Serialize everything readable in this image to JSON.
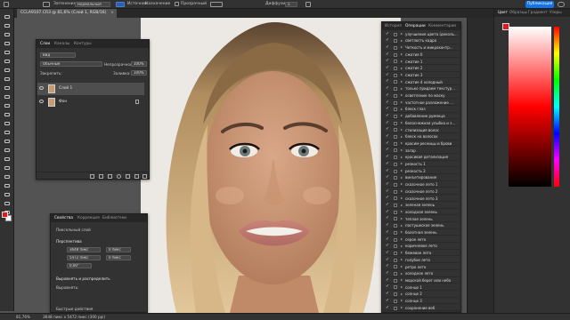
{
  "options_bar": {
    "mode_label": "Затенение:",
    "mode_value": "Нормальный",
    "opacity_label": "Непрозр.:",
    "opacity_value": "100%",
    "flow_label": "Нажим:",
    "flow_value": "100%",
    "source_label": "Источник",
    "destination_label": "Назначение",
    "transparent_label": "Прозрачный",
    "diffusion_label": "Диффузия:",
    "diffusion_value": "5",
    "publish_label": "Публикация"
  },
  "document_tab": {
    "title": "CCLA9107.CR3 @ 81,6% (Слой 1, RGB/16)",
    "close_glyph": "×"
  },
  "layers_panel": {
    "tabs": [
      "Слои",
      "Каналы",
      "Контуры"
    ],
    "kind_filter": "Вид",
    "blend_mode": "Обычные",
    "opacity_label": "Непрозрачность:",
    "opacity_value": "100%",
    "lock_label": "Закрепить:",
    "fill_label": "Заливка:",
    "fill_value": "100%",
    "layers": [
      {
        "name": "Слой 1"
      },
      {
        "name": "Фон"
      }
    ]
  },
  "properties_panel": {
    "tabs": [
      "Свойства",
      "Коррекция",
      "Библиотеки"
    ],
    "layer_type": "Пиксельный слой",
    "transform_label": "Перспектива",
    "width": "3648 пикс",
    "x": "0 пикс",
    "height": "5472 пикс",
    "y": "0 пикс",
    "angle": "0,00°",
    "align_label": "Выровнять и распределить",
    "align_sub": "Выровнять:",
    "quick_actions_label": "Быстрые действия"
  },
  "actions_panel": {
    "tabs": [
      "История",
      "Операции",
      "Комментарии"
    ],
    "items": [
      "улучшение цвета (деколь...",
      "светлость кадра",
      "Четкость и микроконтр...",
      "сжатия 0",
      "сжатие 1",
      "сжатие 2",
      "сжатие 3",
      "сжатие 4 холодный",
      "только придаем текстур...",
      "осветление по маску",
      "частотное разложение ...",
      "блеск глаз",
      "добавление румянца",
      "белоснежная улыбка и з...",
      "стилизация волос",
      "блеск на волосах",
      "красим ресницы и брови",
      "загар",
      "красивая детализация",
      "резкость 1",
      "резкость 2",
      "винъетирование",
      "сказочное лето 1",
      "сказочное лето 2",
      "сказочное лето 3",
      "зеленая зелень",
      "холодная зелень",
      "теплая зелень",
      "пастушеское зелень",
      "болотная зелень",
      "серое лето",
      "коричневое лето",
      "бежевое лето",
      "голубое лето",
      "ретро лето",
      "холодное лето",
      "морской берег или небо",
      "солнце 1",
      "солнце 2",
      "солнце 3",
      "сохранение веб"
    ]
  },
  "color_panel": {
    "tabs": [
      "Цвет",
      "Образцы",
      "Градиент",
      "Узоры"
    ],
    "foreground": "#e01922",
    "background": "#ffffff"
  },
  "status_bar": {
    "zoom": "81,76%",
    "doc_info": "3648 пикс x 5472 пикс (300 ppi)"
  },
  "tools": [
    "move-tool",
    "artboard-tool",
    "marquee-tool",
    "lasso-tool",
    "quick-select-tool",
    "crop-tool",
    "frame-tool",
    "eyedropper-tool",
    "healing-brush-tool",
    "brush-tool",
    "clone-stamp-tool",
    "history-brush-tool",
    "eraser-tool",
    "gradient-tool",
    "blur-tool",
    "dodge-tool",
    "pen-tool",
    "type-tool",
    "path-select-tool",
    "rectangle-tool",
    "hand-tool",
    "zoom-tool",
    "edit-toolbar"
  ]
}
